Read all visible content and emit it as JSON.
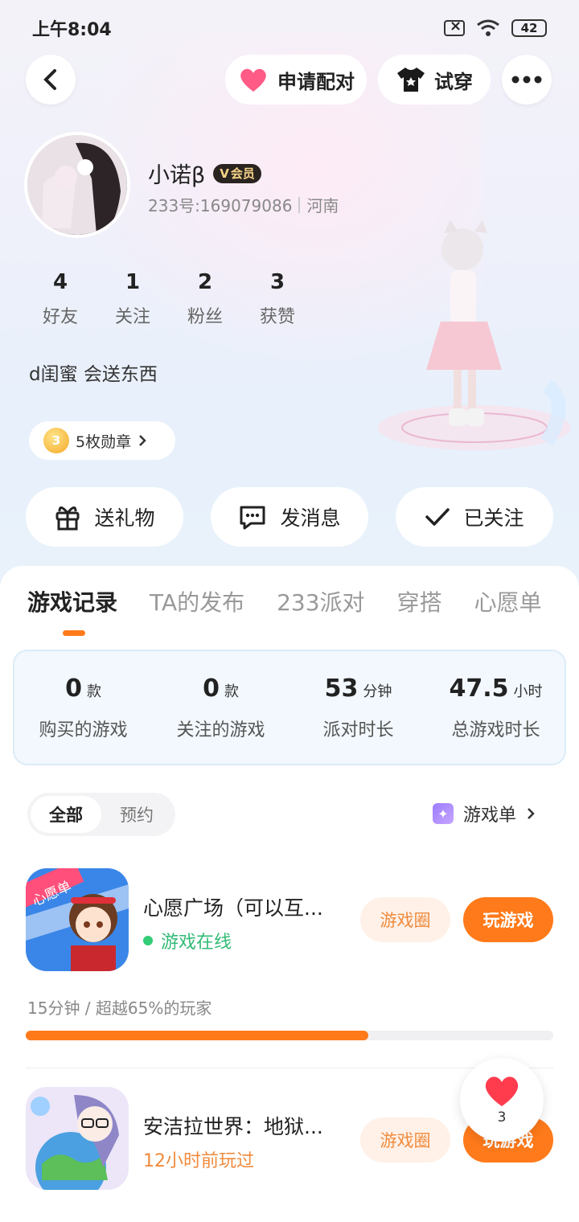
{
  "status_bar": {
    "time": "上午8:04",
    "battery": "42"
  },
  "header": {
    "pair_label": "申请配对",
    "tryon_label": "试穿"
  },
  "profile": {
    "nickname": "小诺β",
    "vip_label": "会员",
    "uid": "233号:169079086",
    "region": "河南",
    "stats": [
      {
        "num": "4",
        "label": "好友"
      },
      {
        "num": "1",
        "label": "关注"
      },
      {
        "num": "2",
        "label": "粉丝"
      },
      {
        "num": "3",
        "label": "获赞"
      }
    ],
    "signature": "d闺蜜  会送东西",
    "medals_label": "5枚勋章",
    "medal_num": "3"
  },
  "actions": {
    "gift": "送礼物",
    "message": "发消息",
    "followed": "已关注"
  },
  "tabs": [
    "游戏记录",
    "TA的发布",
    "233派对",
    "穿搭",
    "心愿单"
  ],
  "summary": [
    {
      "num": "0",
      "unit": "款",
      "label": "购买的游戏"
    },
    {
      "num": "0",
      "unit": "款",
      "label": "关注的游戏"
    },
    {
      "num": "53",
      "unit": "分钟",
      "label": "派对时长"
    },
    {
      "num": "47.5",
      "unit": "小时",
      "label": "总游戏时长"
    }
  ],
  "filter": {
    "all": "全部",
    "reserve": "预约"
  },
  "game_list_link": "游戏单",
  "games": [
    {
      "title": "心愿广场（可以互...",
      "status": "游戏在线",
      "circle_label": "游戏圈",
      "play_label": "玩游戏",
      "progress_text": "15分钟 / 超越65%的玩家",
      "progress": 0.65,
      "icon_badge": "心愿单"
    },
    {
      "title": "安洁拉世界：地狱...",
      "status": "12小时前玩过",
      "circle_label": "游戏圈",
      "play_label": "玩游戏"
    }
  ],
  "floating_like": {
    "count": "3"
  },
  "colors": {
    "accent": "#ff7a1a",
    "online": "#33cc77",
    "recent": "#f08a3c"
  }
}
